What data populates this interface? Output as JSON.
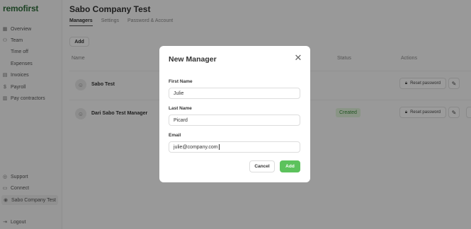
{
  "brand": {
    "logo": "remofirst",
    "accent": "#5cc25c"
  },
  "sidebar": {
    "items": [
      {
        "label": "Overview",
        "icon": "grid-icon"
      },
      {
        "label": "Team",
        "icon": "people-icon"
      },
      {
        "label": "Time off",
        "icon": ""
      },
      {
        "label": "Expenses",
        "icon": ""
      },
      {
        "label": "Invoices",
        "icon": "document-icon"
      },
      {
        "label": "Payroll",
        "icon": "dollar-icon"
      },
      {
        "label": "Pay contractors",
        "icon": "calendar-icon"
      }
    ],
    "bottom": [
      {
        "label": "Support",
        "icon": "support-icon"
      },
      {
        "label": "Connect",
        "icon": "chat-icon"
      },
      {
        "label": "Sabo Company Test",
        "icon": "company-icon"
      },
      {
        "label": "Logout",
        "icon": "logout-icon"
      }
    ]
  },
  "header": {
    "title": "Sabo Company Test"
  },
  "tabs": [
    "Managers",
    "Settings",
    "Password & Account"
  ],
  "toolbar": {
    "add_label": "Add"
  },
  "table": {
    "columns": [
      "Name",
      "Status",
      "Actions"
    ],
    "rows": [
      {
        "name": "Sabo Test",
        "status": "",
        "reset_label": "Reset password"
      },
      {
        "name": "Dari Sabo Test Manager",
        "status": "Created",
        "reset_label": "Reset password"
      }
    ]
  },
  "modal": {
    "title": "New Manager",
    "fields": [
      {
        "label": "First Name",
        "value": "Julie"
      },
      {
        "label": "Last Name",
        "value": "Picard"
      },
      {
        "label": "Email",
        "value": "julie@company.com"
      }
    ],
    "cancel_label": "Cancel",
    "add_label": "Add"
  }
}
